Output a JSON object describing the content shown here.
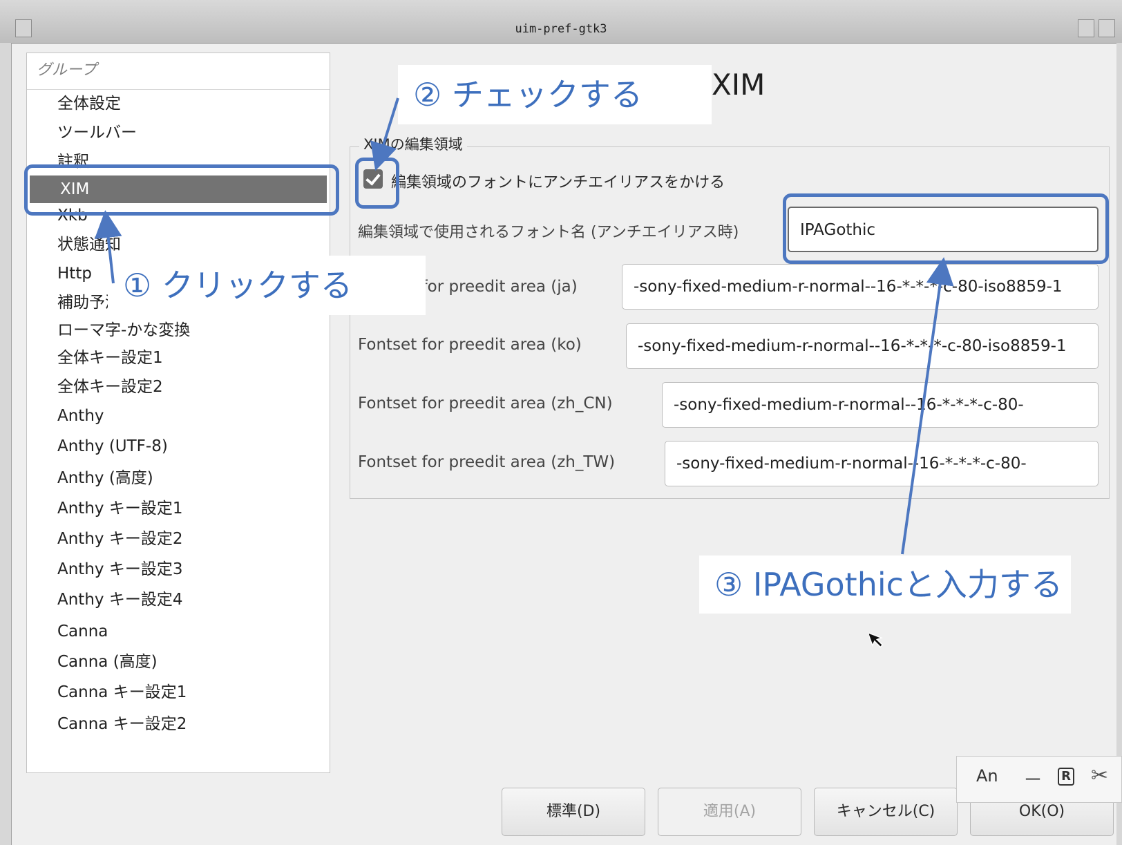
{
  "window": {
    "title": "uim-pref-gtk3"
  },
  "groups": {
    "header": "グループ",
    "items": [
      "全体設定",
      "ツールバー",
      "註釈",
      "XIM",
      "Xkb",
      "状態通知",
      "Http",
      "補助予測入力",
      "ローマ字-かな変換",
      "全体キー設定1",
      "全体キー設定2",
      "Anthy",
      "Anthy (UTF-8)",
      "Anthy (高度)",
      "Anthy キー設定1",
      "Anthy キー設定2",
      "Anthy キー設定3",
      "Anthy キー設定4",
      "Canna",
      "Canna (高度)",
      "Canna キー設定1",
      "Canna キー設定2"
    ],
    "selected": "XIM"
  },
  "page": {
    "title": "XIM",
    "frame_label": "XIMの編集領域",
    "antialias": {
      "label": "編集領域のフォントにアンチエイリアスをかける",
      "checked": true
    },
    "fields": [
      {
        "label": "編集領域で使用されるフォント名 (アンチエイリアス時)",
        "value": "IPAGothic"
      },
      {
        "label": "Fontset for preedit area (ja)",
        "value": "-sony-fixed-medium-r-normal--16-*-*-*-c-80-iso8859-1"
      },
      {
        "label": "Fontset for preedit area (ko)",
        "value": "-sony-fixed-medium-r-normal--16-*-*-*-c-80-iso8859-1"
      },
      {
        "label": "Fontset for preedit area (zh_CN)",
        "value": "-sony-fixed-medium-r-normal--16-*-*-*-c-80-"
      },
      {
        "label": "Fontset for preedit area (zh_TW)",
        "value": "-sony-fixed-medium-r-normal--16-*-*-*-c-80-"
      }
    ]
  },
  "buttons": {
    "default": "標準(D)",
    "apply": "適用(A)",
    "cancel": "キャンセル(C)",
    "ok": "OK(O)"
  },
  "im_toolbar": {
    "mode": "An",
    "minus": "－",
    "r": "R",
    "tool_icon": "tool-icon"
  },
  "annotations": {
    "step1": "① クリックする",
    "step2": "② チェックする",
    "step3": "③ IPAGothicと入力する"
  },
  "colors": {
    "annotation": "#3d6fbd",
    "selected_bg": "#737373"
  }
}
